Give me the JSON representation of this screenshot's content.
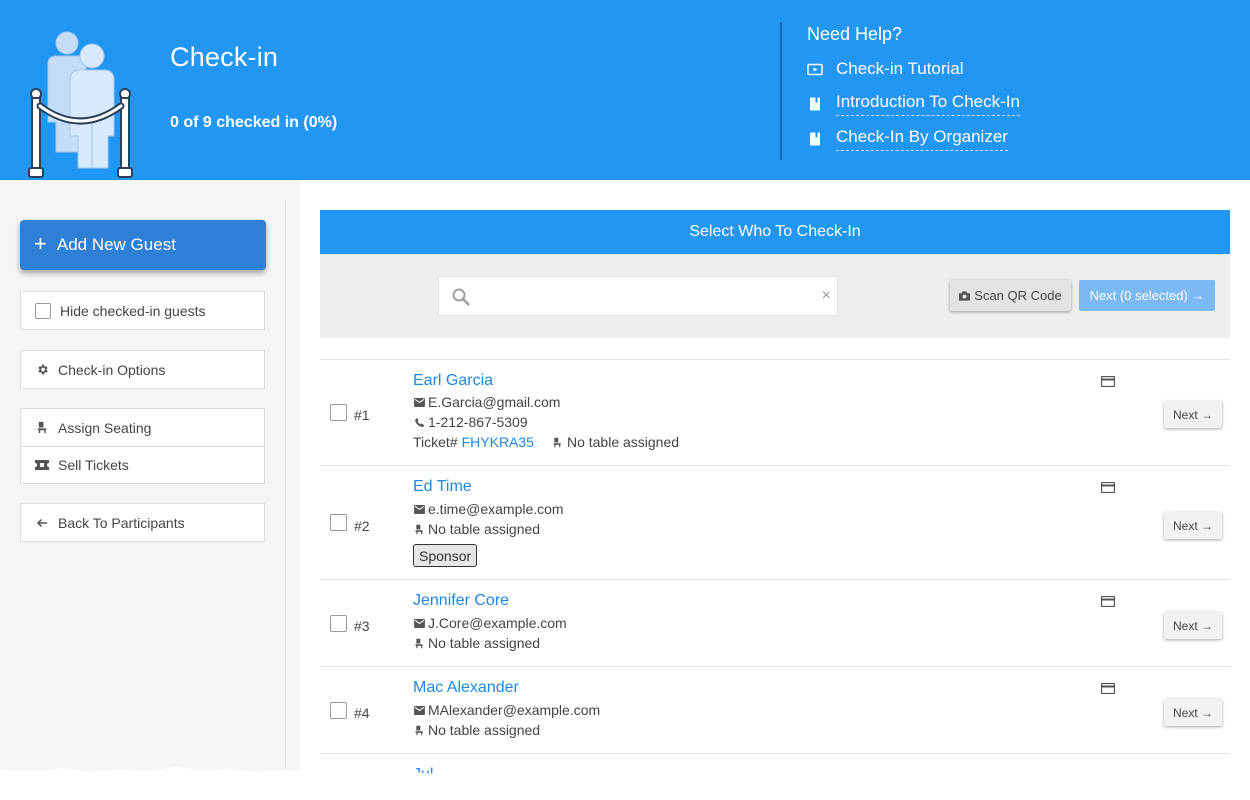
{
  "header": {
    "title": "Check-in",
    "stats": "0 of 9 checked in (0%)",
    "help": {
      "title": "Need Help?",
      "links": [
        {
          "label": "Check-in Tutorial",
          "icon": "video-icon"
        },
        {
          "label": "Introduction To Check-In",
          "icon": "book-icon"
        },
        {
          "label": "Check-In By Organizer",
          "icon": "book-icon"
        }
      ]
    }
  },
  "sidebar": {
    "add_guest_label": "Add New Guest",
    "hide_checked_label": "Hide checked-in guests",
    "options_label": "Check-in Options",
    "assign_seating_label": "Assign Seating",
    "sell_tickets_label": "Sell Tickets",
    "back_label": "Back To Participants"
  },
  "main": {
    "panel_title": "Select Who To Check-In",
    "search": {
      "value": "",
      "placeholder": "",
      "clear": "×"
    },
    "scan_label": "Scan QR Code",
    "next_selected_label": "Next (0 selected) →"
  },
  "guests": [
    {
      "number": "#1",
      "name": "Earl Garcia",
      "email": "E.Garcia@gmail.com",
      "phone": "1-212-867-5309",
      "ticket_prefix": "Ticket#",
      "ticket": "FHYKRA35",
      "table": "No table assigned",
      "next": "Next →"
    },
    {
      "number": "#2",
      "name": "Ed Time",
      "email": "e.time@example.com",
      "table": "No table assigned",
      "badge": "Sponsor",
      "next": "Next →"
    },
    {
      "number": "#3",
      "name": "Jennifer Core",
      "email": "J.Core@example.com",
      "table": "No table assigned",
      "next": "Next →"
    },
    {
      "number": "#4",
      "name": "Mac Alexander",
      "email": "MAlexander@example.com",
      "table": "No table assigned",
      "next": "Next →"
    }
  ],
  "partial_next_guest": "Jul",
  "colors": {
    "primary": "#2196f3",
    "button_blue": "#2e7fd6",
    "link_blue": "#1e88e5",
    "next_disabled": "#7ab9f3"
  }
}
